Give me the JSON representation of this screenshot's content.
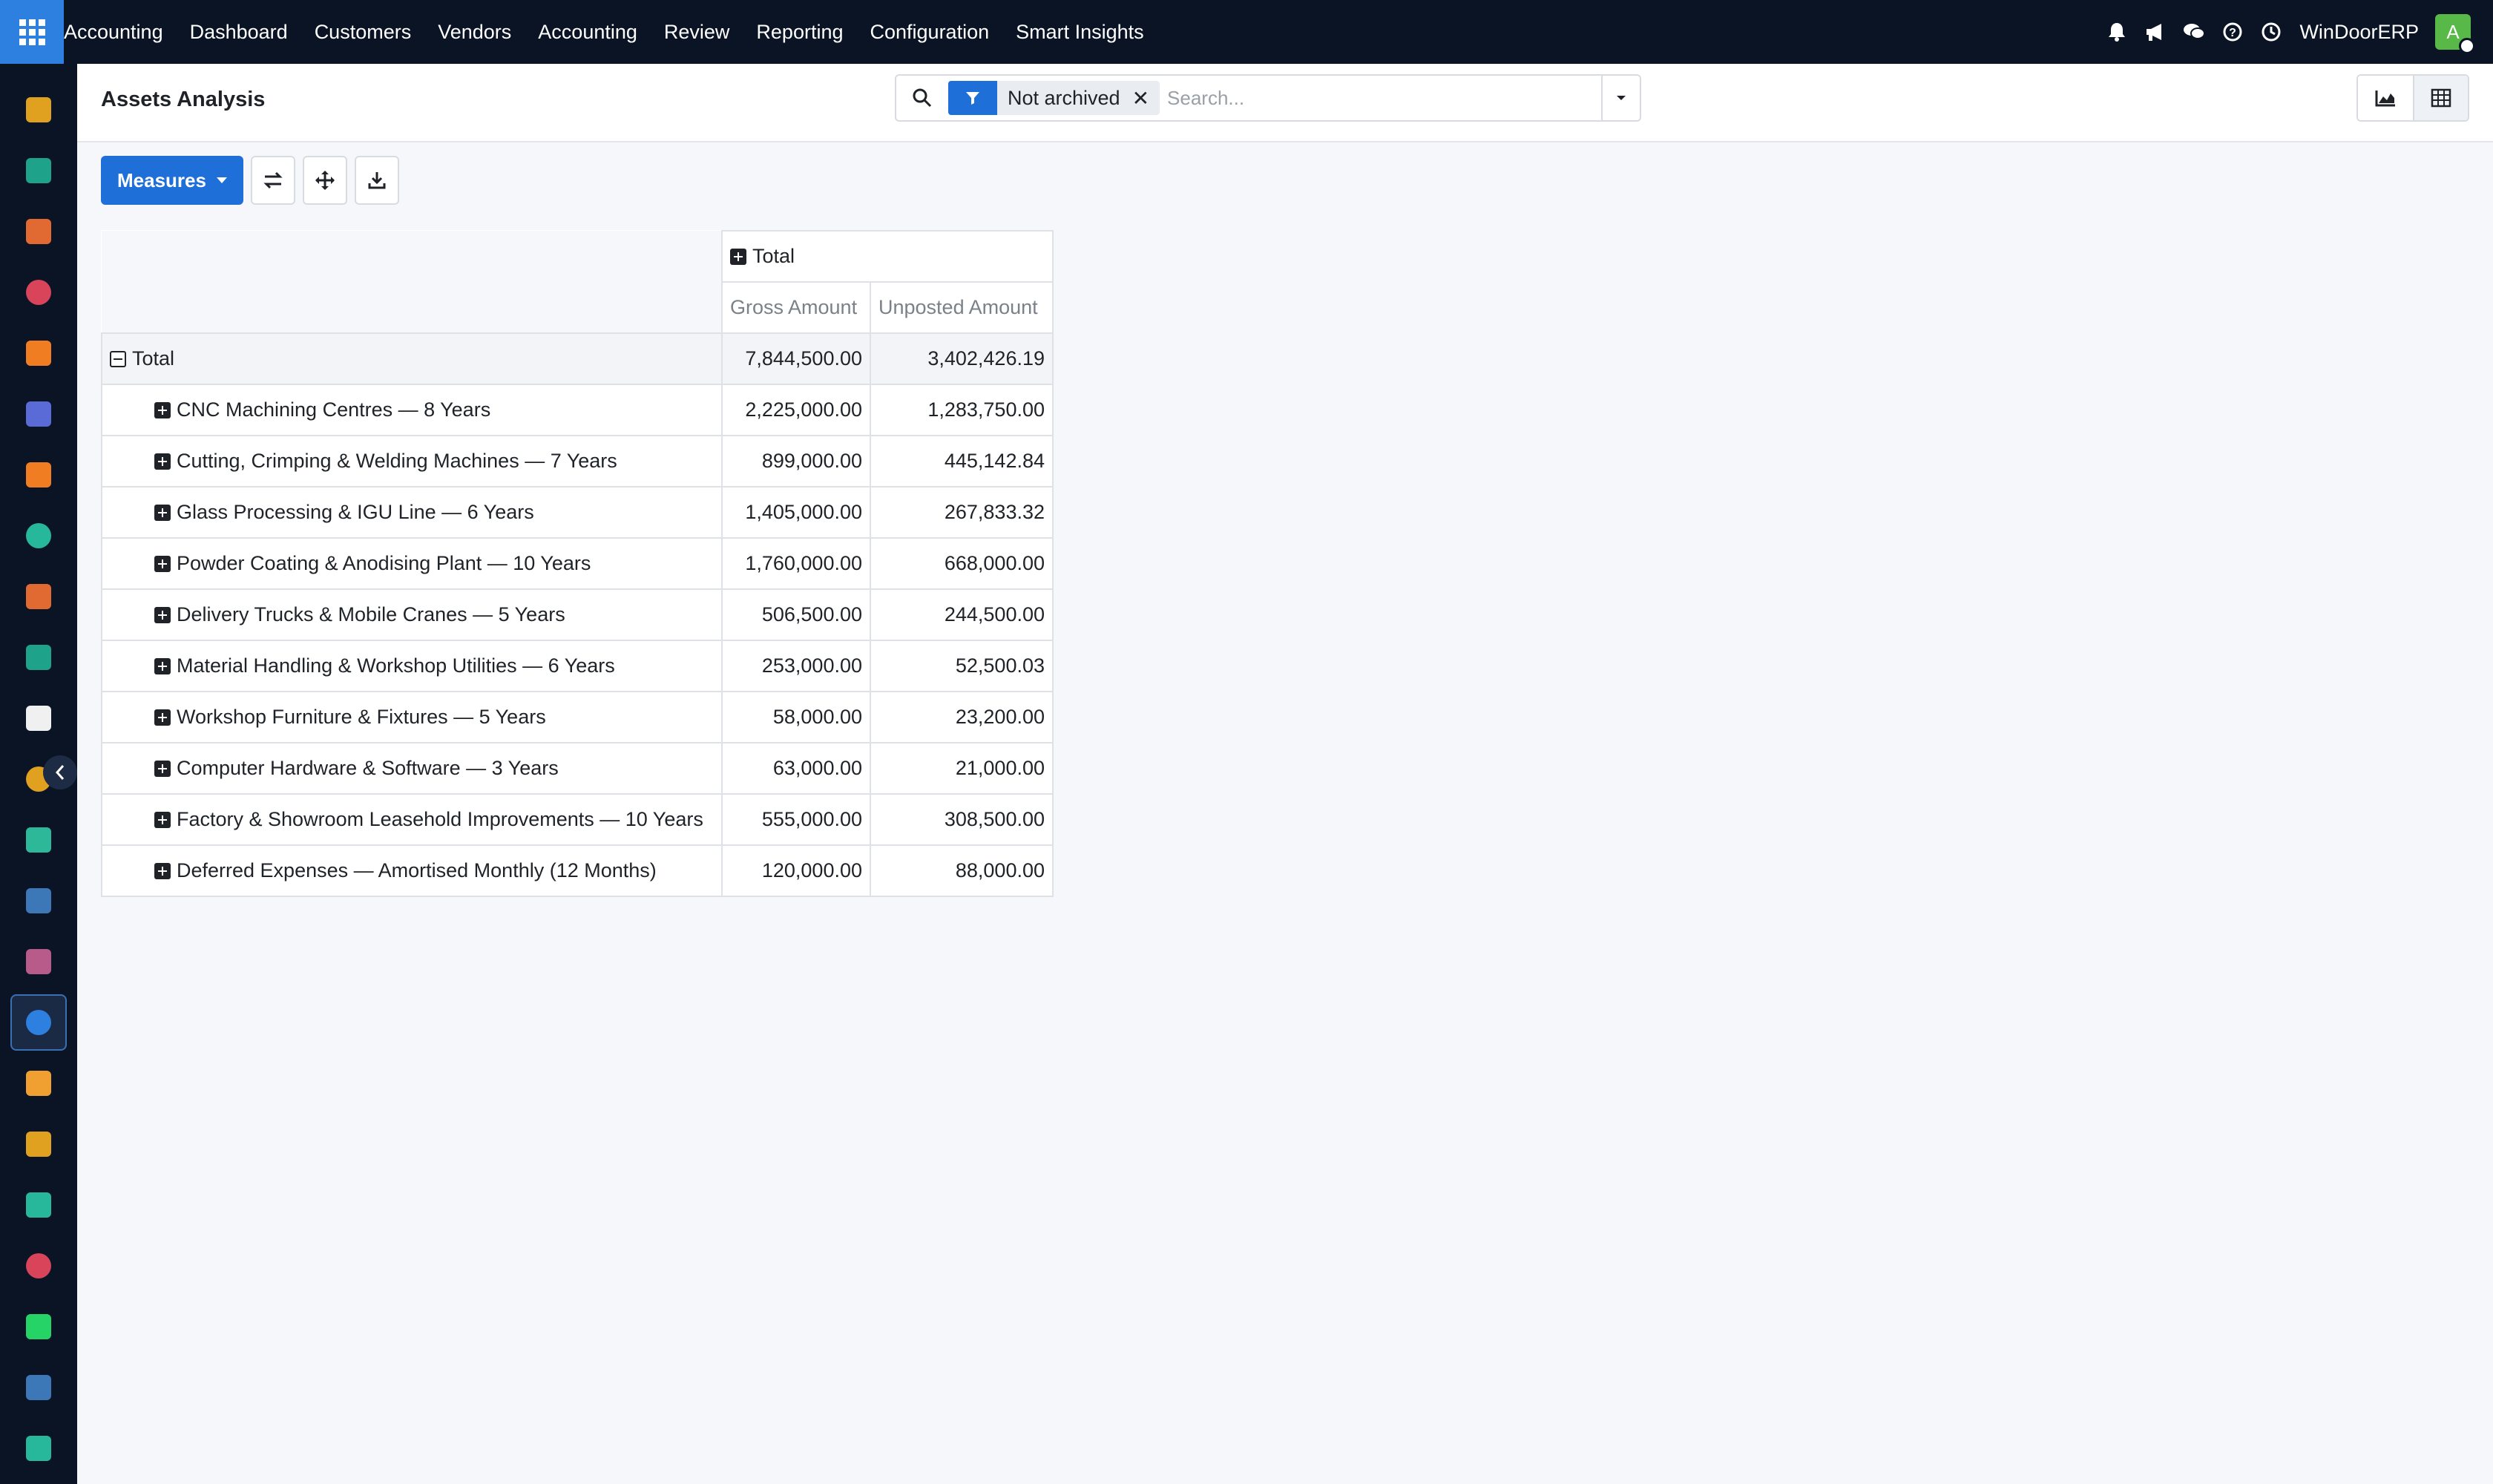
{
  "topbar": {
    "brand": "Accounting",
    "nav": [
      "Dashboard",
      "Customers",
      "Vendors",
      "Accounting",
      "Review",
      "Reporting",
      "Configuration",
      "Smart Insights"
    ],
    "company": "WinDoorERP",
    "avatar_letter": "A",
    "icons": [
      "bell-icon",
      "megaphone-icon",
      "chat-icon",
      "help-icon",
      "clock-icon"
    ]
  },
  "sidebar": {
    "apps": [
      {
        "icon": "discuss-app-icon",
        "color": "#e0a020"
      },
      {
        "icon": "contacts-app-icon",
        "color": "#1fa28a"
      },
      {
        "icon": "reports-app-icon",
        "color": "#e06a32"
      },
      {
        "icon": "dashboards-app-icon",
        "color": "#d9445a"
      },
      {
        "icon": "crm-app-icon",
        "color": "#f07d22"
      },
      {
        "icon": "email-marketing-app-icon",
        "color": "#5a6bd8"
      },
      {
        "icon": "livechat-app-icon",
        "color": "#f07d22"
      },
      {
        "icon": "sign-app-icon",
        "color": "#27b89b"
      },
      {
        "icon": "analytics-app-icon",
        "color": "#e06a32"
      },
      {
        "icon": "employees-app-icon",
        "color": "#1fa28a"
      },
      {
        "icon": "inventory-app-icon",
        "color": "#f0f0f0"
      },
      {
        "icon": "notes-app-icon",
        "color": "#e0a020"
      },
      {
        "icon": "project-app-icon",
        "color": "#2eb89a"
      },
      {
        "icon": "knowledge-app-icon",
        "color": "#3c78b8"
      },
      {
        "icon": "packages-app-icon",
        "color": "#b85a8a"
      },
      {
        "icon": "accounting-app-icon",
        "color": "#2d7fe0"
      },
      {
        "icon": "team-app-icon",
        "color": "#f0a030"
      },
      {
        "icon": "calendar-app-icon",
        "color": "#e0a020"
      },
      {
        "icon": "sign-pen-app-icon",
        "color": "#27b89b"
      },
      {
        "icon": "website-app-icon",
        "color": "#d9445a"
      },
      {
        "icon": "whatsapp-app-icon",
        "color": "#25d366"
      },
      {
        "icon": "timer-app-icon",
        "color": "#3c78b8"
      },
      {
        "icon": "events-app-icon",
        "color": "#27b89b"
      }
    ],
    "active_index": 15
  },
  "control_panel": {
    "title": "Assets Analysis",
    "facet_value": "Not archived",
    "search_placeholder": "Search..."
  },
  "actions": {
    "measures_label": "Measures"
  },
  "pivot": {
    "col_total": "Total",
    "measures": [
      "Gross Amount",
      "Unposted Amount"
    ],
    "total_row": {
      "label": "Total",
      "gross": "7,844,500.00",
      "unposted": "3,402,426.19"
    },
    "rows": [
      {
        "label": "CNC Machining Centres — 8 Years",
        "gross": "2,225,000.00",
        "unposted": "1,283,750.00"
      },
      {
        "label": "Cutting, Crimping & Welding Machines — 7 Years",
        "gross": "899,000.00",
        "unposted": "445,142.84"
      },
      {
        "label": "Glass Processing & IGU Line — 6 Years",
        "gross": "1,405,000.00",
        "unposted": "267,833.32"
      },
      {
        "label": "Powder Coating & Anodising Plant — 10 Years",
        "gross": "1,760,000.00",
        "unposted": "668,000.00"
      },
      {
        "label": "Delivery Trucks & Mobile Cranes — 5 Years",
        "gross": "506,500.00",
        "unposted": "244,500.00"
      },
      {
        "label": "Material Handling & Workshop Utilities — 6 Years",
        "gross": "253,000.00",
        "unposted": "52,500.03"
      },
      {
        "label": "Workshop Furniture & Fixtures — 5 Years",
        "gross": "58,000.00",
        "unposted": "23,200.00"
      },
      {
        "label": "Computer Hardware & Software — 3 Years",
        "gross": "63,000.00",
        "unposted": "21,000.00"
      },
      {
        "label": "Factory & Showroom Leasehold Improvements — 10 Years",
        "gross": "555,000.00",
        "unposted": "308,500.00"
      },
      {
        "label": "Deferred Expenses — Amortised Monthly (12 Months)",
        "gross": "120,000.00",
        "unposted": "88,000.00"
      }
    ]
  }
}
